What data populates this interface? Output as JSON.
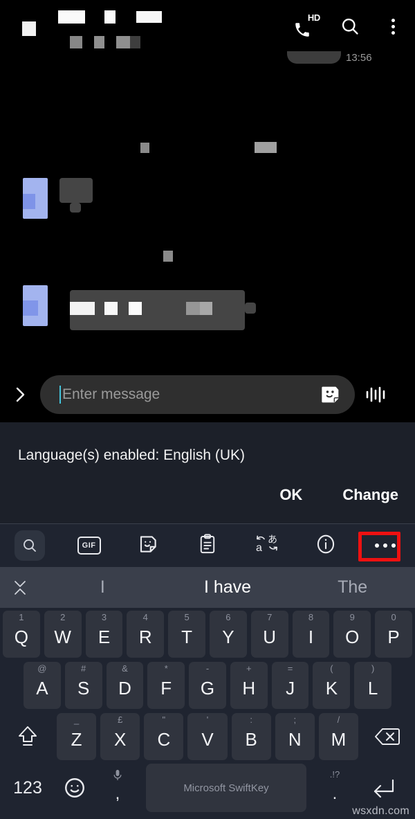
{
  "appbar": {
    "censored_title": true,
    "actions": [
      {
        "name": "hd-call-icon",
        "label": "HD"
      },
      {
        "name": "search-icon",
        "label": ""
      },
      {
        "name": "overflow-menu-icon",
        "label": ""
      }
    ]
  },
  "chat": {
    "partial_timestamp": "13:56",
    "messages_censored": true
  },
  "compose": {
    "placeholder": "Enter message",
    "value": "",
    "expand_icon": "chevron-right-icon",
    "sticker_icon": "sticker-icon",
    "voice_icon": "voice-waveform-icon"
  },
  "language_notice": {
    "text": "Language(s) enabled: English (UK)",
    "ok_label": "OK",
    "change_label": "Change"
  },
  "keyboard_toolbar": {
    "items": [
      {
        "name": "search-icon",
        "label": "",
        "highlighted_bg": true
      },
      {
        "name": "gif-icon",
        "label": "GIF",
        "highlighted_bg": false
      },
      {
        "name": "sticker-icon",
        "label": "",
        "highlighted_bg": false
      },
      {
        "name": "clipboard-icon",
        "label": "",
        "highlighted_bg": false
      },
      {
        "name": "translate-icon",
        "label": "",
        "highlighted_bg": false
      },
      {
        "name": "info-icon",
        "label": "",
        "highlighted_bg": false
      },
      {
        "name": "more-icon",
        "label": "",
        "highlighted_bg": false
      }
    ],
    "highlight_color": "#ee1111",
    "highlighted_item": "more-icon"
  },
  "suggestions": {
    "close_icon": "collapse-icon",
    "items": [
      {
        "text": "I",
        "selected": false
      },
      {
        "text": "I have",
        "selected": true
      },
      {
        "text": "The",
        "selected": false
      }
    ]
  },
  "keyboard": {
    "row1": [
      {
        "sup": "1",
        "main": "Q"
      },
      {
        "sup": "2",
        "main": "W"
      },
      {
        "sup": "3",
        "main": "E"
      },
      {
        "sup": "4",
        "main": "R"
      },
      {
        "sup": "5",
        "main": "T"
      },
      {
        "sup": "6",
        "main": "Y"
      },
      {
        "sup": "7",
        "main": "U"
      },
      {
        "sup": "8",
        "main": "I"
      },
      {
        "sup": "9",
        "main": "O"
      },
      {
        "sup": "0",
        "main": "P"
      }
    ],
    "row2": [
      {
        "sup": "@",
        "main": "A"
      },
      {
        "sup": "#",
        "main": "S"
      },
      {
        "sup": "&",
        "main": "D"
      },
      {
        "sup": "*",
        "main": "F"
      },
      {
        "sup": "-",
        "main": "G"
      },
      {
        "sup": "+",
        "main": "H"
      },
      {
        "sup": "=",
        "main": "J"
      },
      {
        "sup": "(",
        "main": "K"
      },
      {
        "sup": ")",
        "main": "L"
      }
    ],
    "row3": [
      {
        "sup": "_",
        "main": "Z"
      },
      {
        "sup": "£",
        "main": "X"
      },
      {
        "sup": "\"",
        "main": "C"
      },
      {
        "sup": "'",
        "main": "V"
      },
      {
        "sup": ":",
        "main": "B"
      },
      {
        "sup": ";",
        "main": "N"
      },
      {
        "sup": "/",
        "main": "M"
      }
    ],
    "shift_icon": "shift-icon",
    "backspace_icon": "backspace-icon",
    "numeric_label": "123",
    "emoji_icon": "emoji-icon",
    "comma_key": {
      "sup": "mic-icon",
      "main": ","
    },
    "spacebar_label": "Microsoft SwiftKey",
    "period_key": {
      "sup": ".!?",
      "main": "."
    },
    "enter_icon": "enter-icon"
  },
  "watermark": {
    "text": "wsxdn.com"
  }
}
